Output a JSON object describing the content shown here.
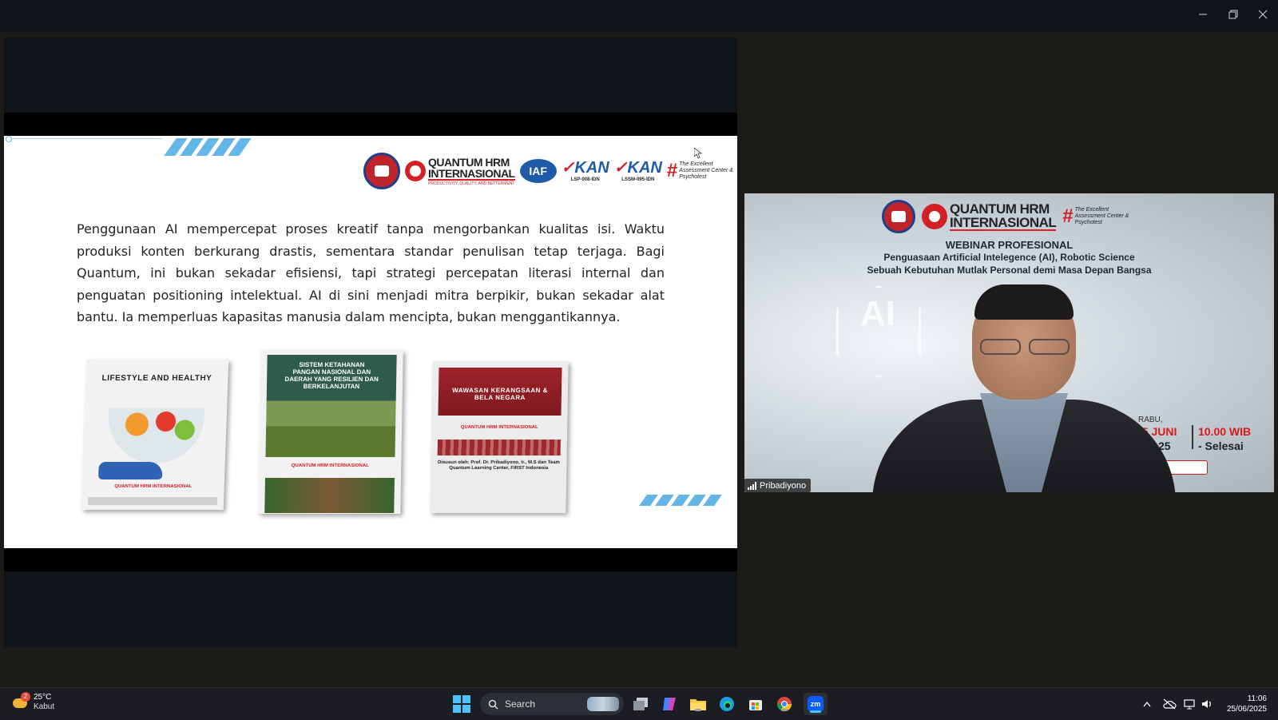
{
  "window": {
    "minimize_label": "Minimize",
    "restore_label": "Restore",
    "close_label": "Close"
  },
  "slide": {
    "logos": {
      "quantum_line1": "QUANTUM HRM",
      "quantum_line2": "INTERNASIONAL",
      "quantum_tagline": "PRODUCTIVITY, QUALITY, AND BETTERMENT",
      "iaf": "IAF",
      "kan1_code": "LSP-008-IDN",
      "kan2_code": "LSSM-095-IDN",
      "kan_label": "KAN",
      "excellent": "The Excellent Assessment Center & Psychotest"
    },
    "paragraph": "Penggunaan AI mempercepat proses kreatif tanpa mengorbankan kualitas isi. Waktu produksi konten berkurang drastis, sementara standar penulisan tetap terjaga. Bagi Quantum, ini bukan sekadar efisiensi, tapi strategi percepatan literasi internal dan penguatan positioning intelektual. AI di sini menjadi mitra berpikir, bukan sekadar alat bantu. Ia memperluas kapasitas manusia dalam mencipta, bukan menggantikannya.",
    "books": [
      {
        "title": "LIFESTYLE AND HEALTHY",
        "logo": "QUANTUM HRM INTERNASIONAL"
      },
      {
        "title": "SISTEM KETAHANAN PANGAN NASIONAL DAN DAERAH YANG RESILIEN DAN BERKELANJUTAN",
        "logo": "QUANTUM HRM INTERNASIONAL"
      },
      {
        "title": "WAWASAN KERANGSAAN & BELA NEGARA",
        "logo": "QUANTUM HRM INTERNASIONAL",
        "author": "Disusun oleh: Prof. Dr. Pribadiyono, Ir., M.S dan Team Quantum Learning Center, FIRST Indonesia"
      }
    ]
  },
  "video": {
    "logo_line1": "QUANTUM HRM",
    "logo_line2": "INTERNASIONAL",
    "logo_excellent": "The Excellent Assessment Center & Psychotest",
    "heading": "WEBINAR PROFESIONAL",
    "subtitle1": "Penguasaan Artificial Intelegence (AI), Robotic Science",
    "subtitle2": "Sebuah Kebutuhan Mutlak Personal demi Masa Depan Bangsa",
    "ai_label": "AI",
    "day": "RABU,",
    "date": "25 JUNI",
    "time": "10.00 WIB",
    "year": "25",
    "until": "- Selesai",
    "participant_name": "Pribadiyono"
  },
  "taskbar": {
    "weather_badge": "2",
    "temperature": "25°C",
    "condition": "Kabut",
    "search_label": "Search",
    "zoom_label": "zm",
    "time": "11:06",
    "date": "25/06/2025"
  },
  "colors": {
    "accent_blue": "#4cc2ff",
    "brand_red": "#d32027",
    "slide_stripe": "#63b6e6"
  }
}
